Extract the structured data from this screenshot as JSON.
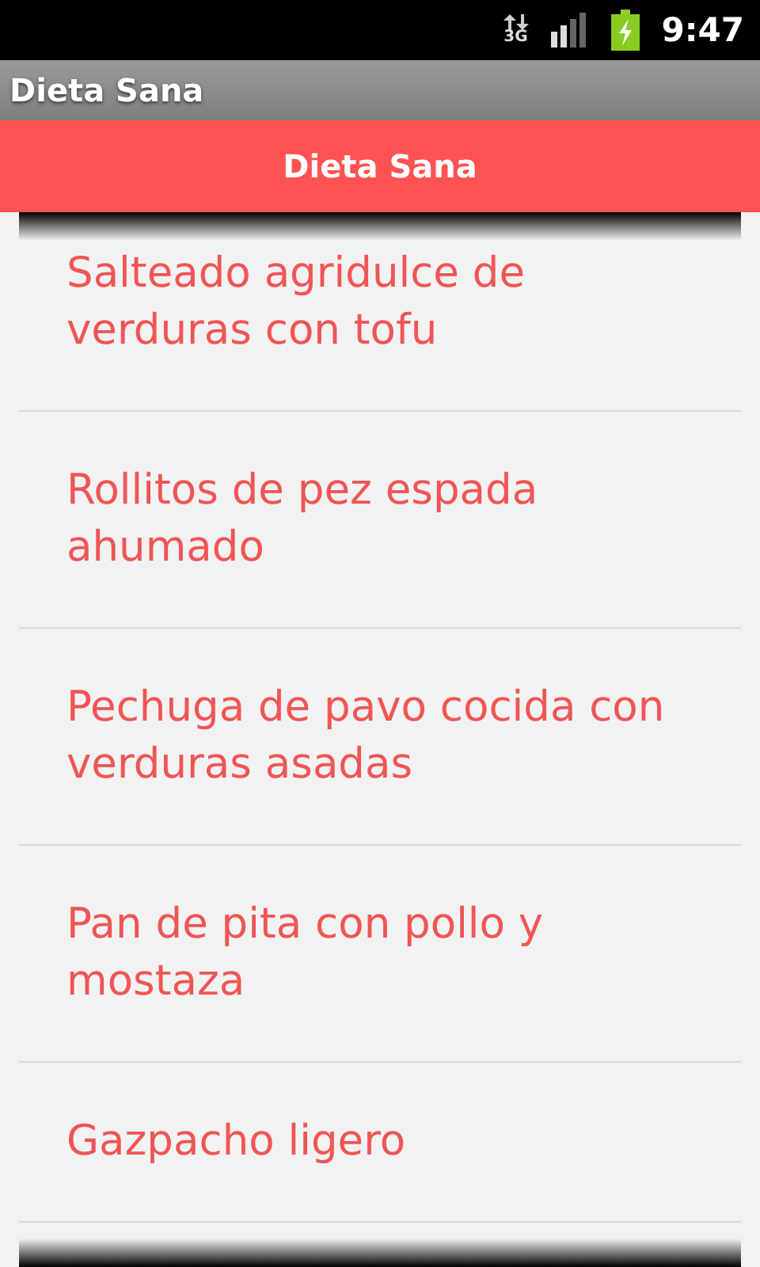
{
  "status_bar": {
    "network": "3G",
    "time": "9:47"
  },
  "window": {
    "title": "Dieta Sana"
  },
  "header": {
    "title": "Dieta Sana"
  },
  "recipes": [
    {
      "name": "Salteado agridulce de verduras con tofu"
    },
    {
      "name": "Rollitos de pez espada ahumado"
    },
    {
      "name": "Pechuga de pavo cocida con verduras asadas"
    },
    {
      "name": "Pan de pita con pollo y mostaza"
    },
    {
      "name": "Gazpacho ligero"
    }
  ]
}
